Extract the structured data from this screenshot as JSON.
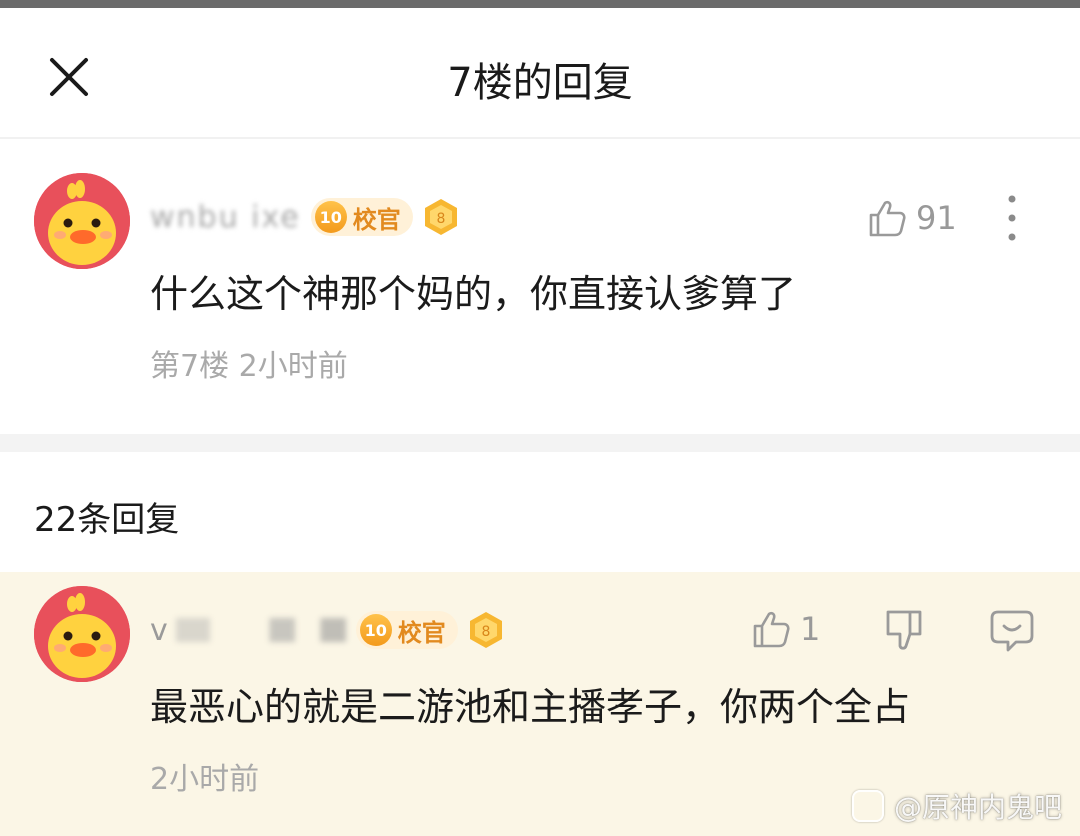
{
  "header": {
    "title": "7楼的回复"
  },
  "main_comment": {
    "username": "wnbu ixe",
    "level": "10",
    "role_badge": "校官",
    "extra_badge": "8",
    "likes": "91",
    "text": "什么这个神那个妈的，你直接认爹算了",
    "meta": "第7楼 2小时前"
  },
  "replies": {
    "count_label": "22条回复",
    "items": [
      {
        "username": "v",
        "level": "10",
        "role_badge": "校官",
        "extra_badge": "8",
        "likes": "1",
        "text": "最恶心的就是二游池和主播孝子，你两个全占",
        "meta": "2小时前"
      }
    ]
  },
  "watermark": {
    "text": "@原神内鬼吧"
  },
  "colors": {
    "reply_highlight": "#fbf6e6",
    "badge_orange": "#f39a1c",
    "avatar_red": "#e8505b",
    "duck_yellow": "#ffd23f"
  }
}
